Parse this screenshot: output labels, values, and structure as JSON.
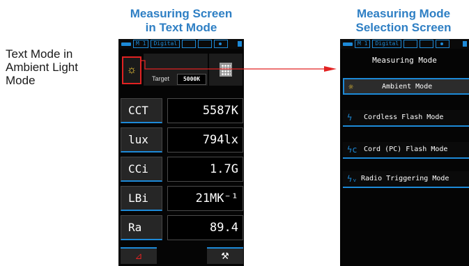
{
  "captions": {
    "left_title": "Measuring Screen",
    "left_subtitle": "in Text Mode",
    "right_title": "Measuring Mode",
    "right_subtitle": "Selection Screen"
  },
  "side_note": {
    "line1": "Text Mode in",
    "line2": "Ambient Light",
    "line3": "Mode"
  },
  "status_bar": {
    "memory_label": "M 1",
    "camera_label": "Digital"
  },
  "left_screen": {
    "mode_icon": "sun-icon",
    "target_label": "Target",
    "target_value": "5000K",
    "measurements": [
      {
        "label": "CCT",
        "value": "5587K"
      },
      {
        "label": "lux",
        "value": "794lx"
      },
      {
        "label": "CCi",
        "value": "1.7G"
      },
      {
        "label": "LBi",
        "value": "21MK⁻¹"
      },
      {
        "label": "Ra",
        "value": "89.4"
      }
    ],
    "bottom_left_icon": "triangle-icon",
    "bottom_left_glyph": "⊿",
    "bottom_right_icon": "wrench-icon",
    "bottom_right_glyph": "⚒"
  },
  "right_screen": {
    "title": "Measuring Mode",
    "modes": [
      {
        "label": "Ambient Mode",
        "icon": "sun-icon",
        "glyph": "☼",
        "selected": true
      },
      {
        "label": "Cordless Flash Mode",
        "icon": "flash-icon",
        "glyph": "ϟ",
        "selected": false
      },
      {
        "label": "Cord (PC) Flash Mode",
        "icon": "flash-cord-icon",
        "glyph": "ϟc",
        "selected": false
      },
      {
        "label": "Radio Triggering Mode",
        "icon": "flash-radio-icon",
        "glyph": "ϟᵥ",
        "selected": false
      }
    ]
  },
  "colors": {
    "accent": "#1d8ad8",
    "highlight": "#e22222",
    "caption": "#2e7fc4",
    "sun": "#ffd23a"
  }
}
